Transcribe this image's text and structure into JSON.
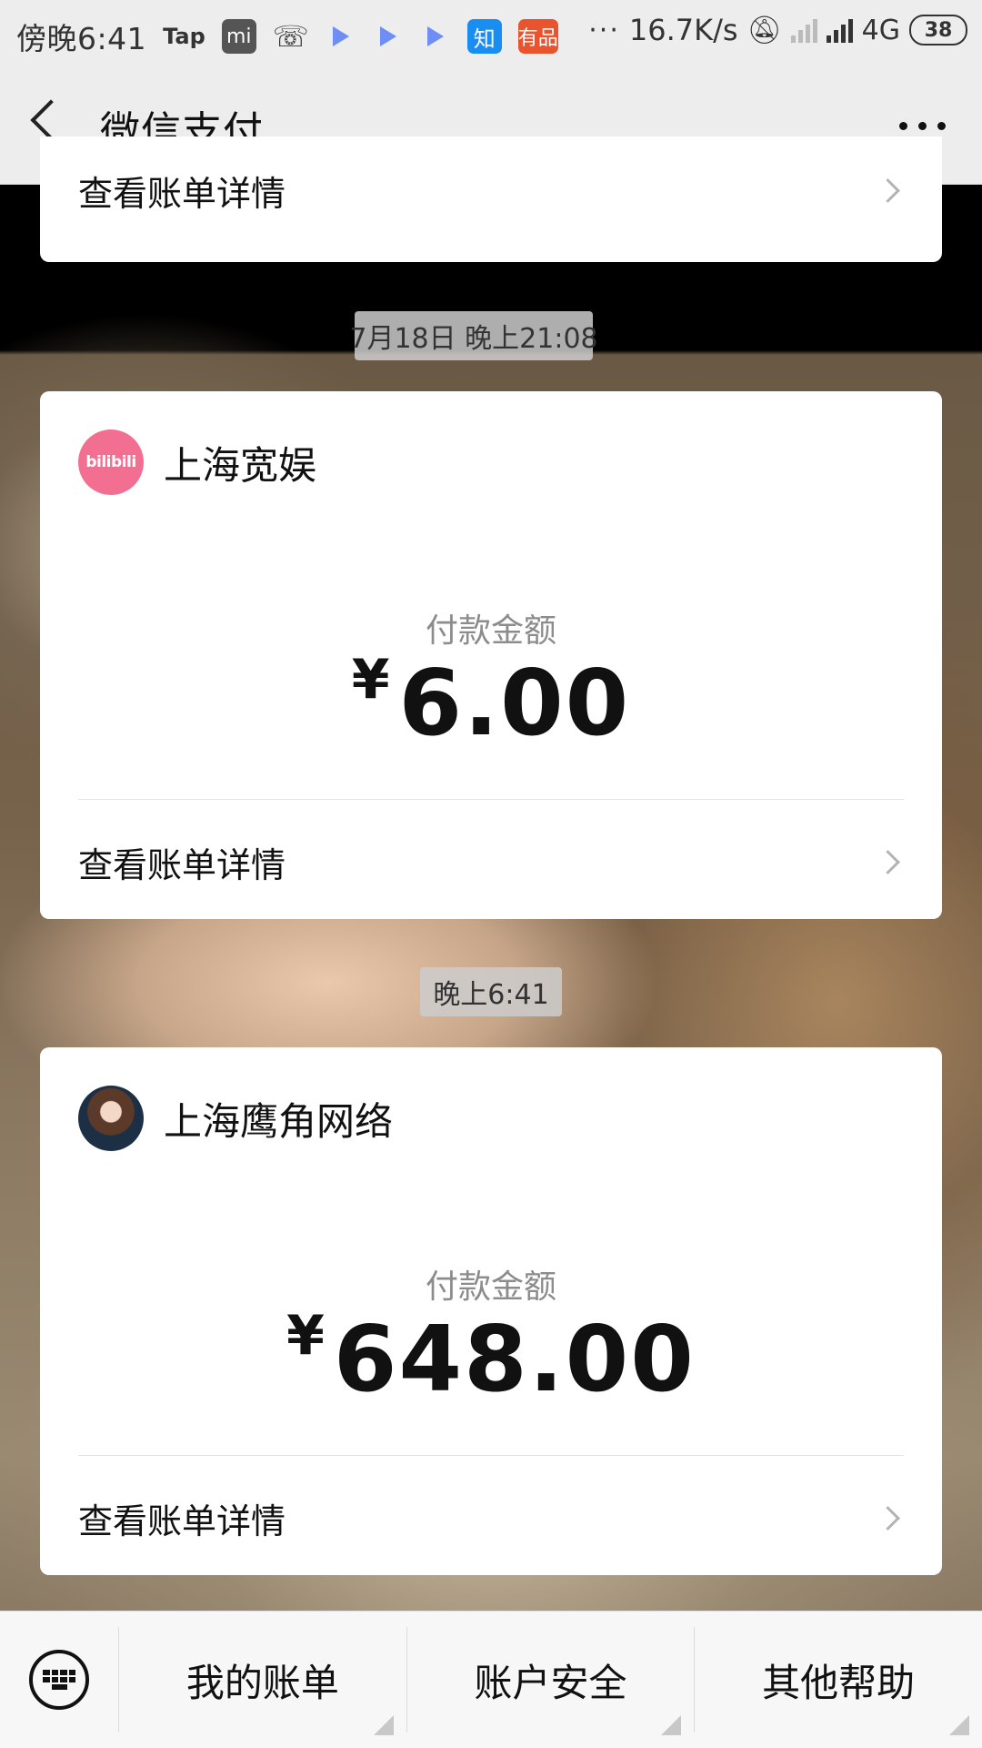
{
  "status_bar": {
    "time": "傍晚6:41",
    "tap_label": "Tap",
    "mi_label": "mi",
    "zhihu_label": "知",
    "fu_label": "有品",
    "overflow": "···",
    "net_speed": "16.7K/s",
    "network": "4G",
    "battery": "38"
  },
  "nav": {
    "title": "微信支付"
  },
  "timeline": [
    {
      "time": "7月18日 晚上21:08",
      "merchant": "上海宽娱",
      "avatar_text": "bilibili",
      "amount_label": "付款金额",
      "currency": "¥",
      "amount": "6.00",
      "detail_label": "查看账单详情"
    },
    {
      "time": "晚上6:41",
      "merchant": "上海鹰角网络",
      "amount_label": "付款金额",
      "currency": "¥",
      "amount": "648.00",
      "detail_label": "查看账单详情"
    }
  ],
  "top_card": {
    "detail_label": "查看账单详情"
  },
  "bottom_menu": {
    "items": [
      "我的账单",
      "账户安全",
      "其他帮助"
    ]
  }
}
